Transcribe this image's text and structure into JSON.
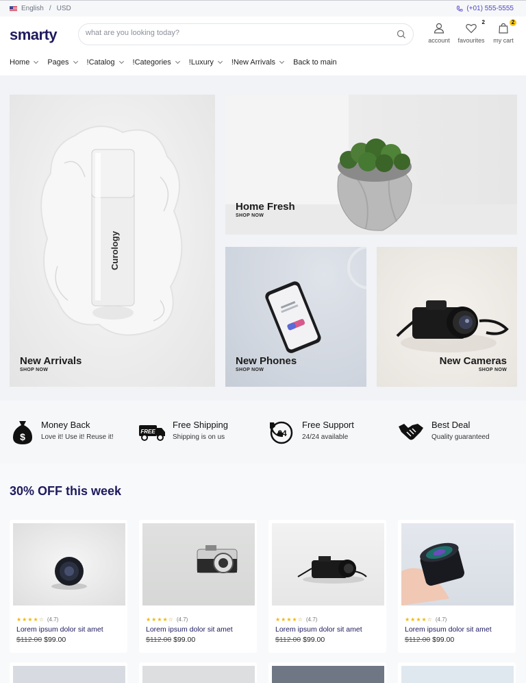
{
  "topbar": {
    "language": "English",
    "separator": "/",
    "currency": "USD",
    "phone": "(+01) 555-5555"
  },
  "header": {
    "logo": "smarty",
    "search_placeholder": "what are you looking today?",
    "account_label": "account",
    "favourites_label": "favourites",
    "favourites_count": "2",
    "cart_label": "my cart",
    "cart_count": "2"
  },
  "nav": [
    {
      "label": "Home",
      "dropdown": true
    },
    {
      "label": "Pages",
      "dropdown": true
    },
    {
      "label": "!Catalog",
      "dropdown": true
    },
    {
      "label": "!Categories",
      "dropdown": true
    },
    {
      "label": "!Luxury",
      "dropdown": true
    },
    {
      "label": "!New Arrivals",
      "dropdown": true
    },
    {
      "label": "Back to main",
      "dropdown": false
    }
  ],
  "hero": [
    {
      "title": "New Arrivals",
      "cta": "SHOP NOW",
      "product_text": "Curology"
    },
    {
      "title": "Home Fresh",
      "cta": "SHOP NOW"
    },
    {
      "title": "New Phones",
      "cta": "SHOP NOW"
    },
    {
      "title": "New Cameras",
      "cta": "SHOP NOW"
    }
  ],
  "features": [
    {
      "title": "Money Back",
      "subtitle": "Love it! Use it! Reuse it!",
      "icon": "money-bag-icon"
    },
    {
      "title": "Free Shipping",
      "subtitle": "Shipping is on us",
      "icon": "delivery-truck-icon",
      "badge": "FREE"
    },
    {
      "title": "Free Support",
      "subtitle": "24/24 available",
      "icon": "support-phone-icon",
      "badge": "24"
    },
    {
      "title": "Best Deal",
      "subtitle": "Quality guaranteed",
      "icon": "handshake-icon"
    }
  ],
  "section_title": "30% OFF this week",
  "products": [
    {
      "name": "Lorem ipsum dolor sit amet",
      "rating": "(4.7)",
      "stars": 4,
      "old_price": "$112.00",
      "price": "$99.00"
    },
    {
      "name": "Lorem ipsum dolor sit amet",
      "rating": "(4.7)",
      "stars": 4,
      "old_price": "$112.00",
      "price": "$99.00"
    },
    {
      "name": "Lorem ipsum dolor sit amet",
      "rating": "(4.7)",
      "stars": 4,
      "old_price": "$112.00",
      "price": "$99.00"
    },
    {
      "name": "Lorem ipsum dolor sit amet",
      "rating": "(4.7)",
      "stars": 4,
      "old_price": "$112.00",
      "price": "$99.00"
    }
  ],
  "colors": {
    "brand": "#1e1a5e",
    "accent": "#4f46c8",
    "star": "#f2b705",
    "badge": "#f5c518"
  }
}
